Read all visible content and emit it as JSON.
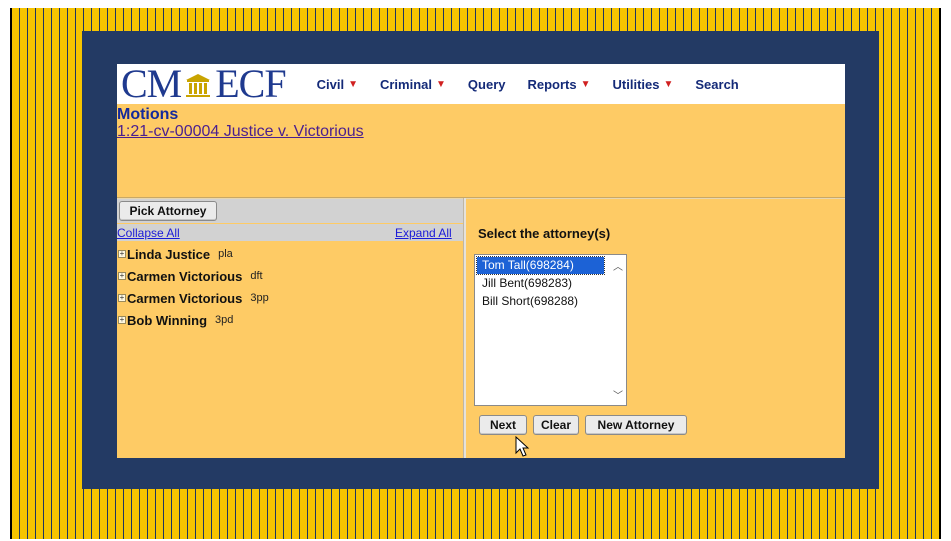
{
  "header": {
    "logo_left": "CM",
    "logo_right": "ECF",
    "menu": [
      {
        "label": "Civil",
        "caret": true
      },
      {
        "label": "Criminal",
        "caret": true
      },
      {
        "label": "Query",
        "caret": false
      },
      {
        "label": "Reports",
        "caret": true
      },
      {
        "label": "Utilities",
        "caret": true
      },
      {
        "label": "Search",
        "caret": false
      }
    ]
  },
  "page": {
    "title": "Motions",
    "case_link": "1:21-cv-00004 Justice v. Victorious"
  },
  "left": {
    "pick_button": "Pick Attorney",
    "collapse_all": "Collapse All",
    "expand_all": "Expand All",
    "parties": [
      {
        "name": "Linda Justice",
        "role": "pla"
      },
      {
        "name": "Carmen Victorious",
        "role": "dft"
      },
      {
        "name": "Carmen Victorious",
        "role": "3pp"
      },
      {
        "name": "Bob Winning",
        "role": "3pd"
      }
    ]
  },
  "right": {
    "select_label": "Select the attorney(s)",
    "attorneys": [
      {
        "label": "Tom Tall(698284)",
        "selected": true
      },
      {
        "label": "Jill Bent(698283)",
        "selected": false
      },
      {
        "label": "Bill Short(698288)",
        "selected": false
      }
    ],
    "next_button": "Next",
    "clear_button": "Clear",
    "new_attorney_button": "New Attorney"
  },
  "colors": {
    "stripe_gold": "#f6c400",
    "navy": "#233a64",
    "panel": "#fecb65",
    "selection": "#1c62d6"
  },
  "icons": [
    "pillar-icon",
    "caret-down-icon",
    "expand-plus-icon",
    "scroll-up-icon",
    "scroll-down-icon",
    "mouse-pointer-icon"
  ]
}
